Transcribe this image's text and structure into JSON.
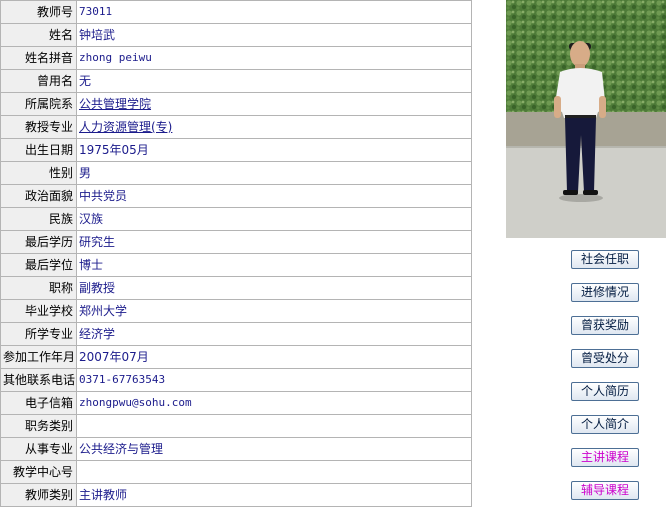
{
  "profile": {
    "rows": [
      {
        "label": "教师号",
        "value": "73011",
        "mono": true
      },
      {
        "label": "姓名",
        "value": "钟培武"
      },
      {
        "label": "姓名拼音",
        "value": "zhong peiwu",
        "mono": true
      },
      {
        "label": "曾用名",
        "value": "无"
      },
      {
        "label": "所属院系",
        "value": "公共管理学院",
        "link": true
      },
      {
        "label": "教授专业",
        "value": "人力资源管理(专)",
        "link": true
      },
      {
        "label": "出生日期",
        "value": "1975年05月"
      },
      {
        "label": "性别",
        "value": "男"
      },
      {
        "label": "政治面貌",
        "value": "中共党员"
      },
      {
        "label": "民族",
        "value": "汉族"
      },
      {
        "label": "最后学历",
        "value": "研究生"
      },
      {
        "label": "最后学位",
        "value": "博士"
      },
      {
        "label": "职称",
        "value": "副教授"
      },
      {
        "label": "毕业学校",
        "value": "郑州大学"
      },
      {
        "label": "所学专业",
        "value": "经济学"
      },
      {
        "label": "参加工作年月",
        "value": "2007年07月"
      },
      {
        "label": "其他联系电话",
        "value": "0371-67763543",
        "mono": true
      },
      {
        "label": "电子信箱",
        "value": "zhongpwu@sohu.com",
        "mono": true
      },
      {
        "label": "职务类别",
        "value": ""
      },
      {
        "label": "从事专业",
        "value": "公共经济与管理"
      },
      {
        "label": "教学中心号",
        "value": ""
      },
      {
        "label": "教师类别",
        "value": "主讲教师"
      }
    ]
  },
  "sidebar": {
    "buttons": [
      {
        "label": "社会任职",
        "color": "#001a40"
      },
      {
        "label": "进修情况",
        "color": "#001a40"
      },
      {
        "label": "曾获奖励",
        "color": "#001a40"
      },
      {
        "label": "曾受处分",
        "color": "#001a40"
      },
      {
        "label": "个人简历",
        "color": "#001a40"
      },
      {
        "label": "个人简介",
        "color": "#001a40"
      },
      {
        "label": "主讲课程",
        "color": "#cc00cc"
      },
      {
        "label": "辅导课程",
        "color": "#cc00cc"
      }
    ]
  }
}
